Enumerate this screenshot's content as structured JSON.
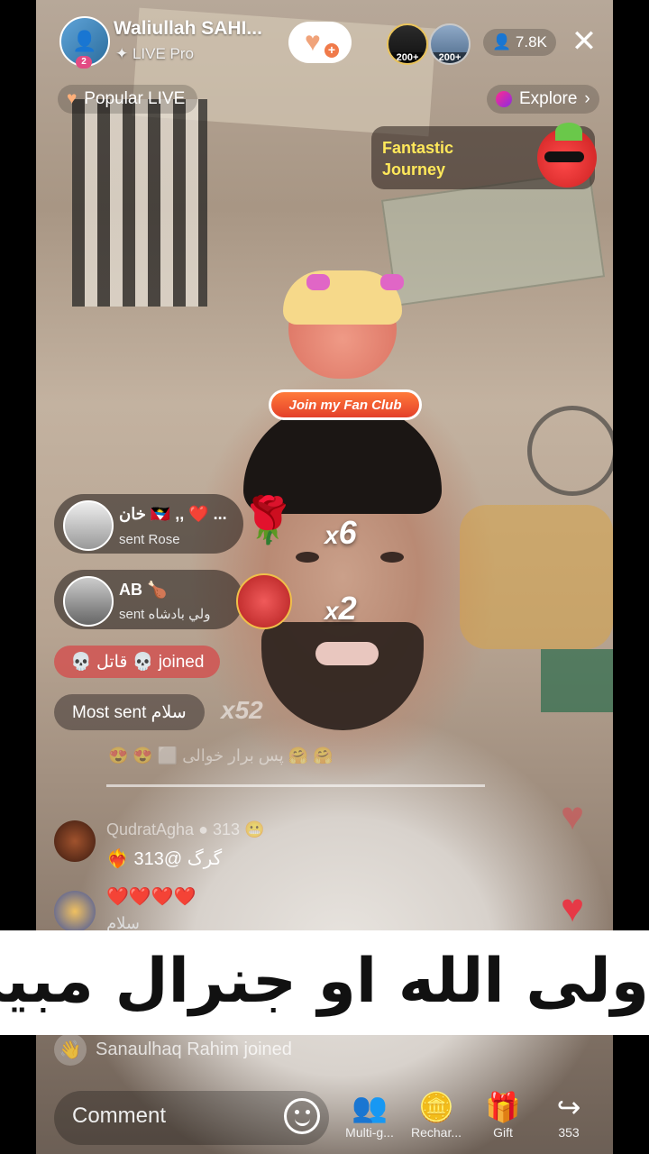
{
  "header": {
    "host_name": "Waliullah SAHI...",
    "host_badge": "2",
    "host_subtitle": "✦ LIVE Pro",
    "viewers": [
      {
        "badge": "200+"
      },
      {
        "badge": "200+"
      }
    ],
    "viewer_count": "7.8K",
    "viewer_icon": "person-icon",
    "close_icon": "close-icon"
  },
  "subnav": {
    "popular_label": "Popular LIVE",
    "explore_label": "Explore"
  },
  "promo": {
    "fantastic_line1": "Fantastic",
    "fantastic_line2": "Journey",
    "fan_club_label": "Join my Fan Club"
  },
  "gifts": [
    {
      "user": "خان 🇦🇬 ,, ❤️ ...",
      "action": "sent Rose",
      "icon": "rose-icon",
      "combo": "6"
    },
    {
      "user": "AB 🍗",
      "action": "sent ولي بادشاه",
      "icon": "badshah-gift-icon",
      "combo": "2"
    }
  ],
  "gift_combo_prefix": "x",
  "joined_pill": "💀 قاتل 💀 joined",
  "most_sent": "Most sent سلام",
  "most_sent_combo": "x52",
  "faint_comment": "😍 😍 ⬜ پس برار خوالی 🤗 🤗",
  "comments": [
    {
      "name": "QudratAgha ● 313 😬",
      "text": "❤️‍🔥 گرگ @313"
    },
    {
      "name": "",
      "text": "❤️❤️❤️❤️",
      "sub": "سلام"
    }
  ],
  "banner_text": "ولی الله او جنرال مبین",
  "joined_bottom": "Sanaulhaq Rahim joined",
  "bottom_bar": {
    "comment_placeholder": "Comment",
    "buttons": [
      {
        "label": "Multi-g...",
        "icon": "multi-guest-icon"
      },
      {
        "label": "Rechar...",
        "icon": "recharge-icon"
      },
      {
        "label": "Gift",
        "icon": "gift-icon"
      },
      {
        "label": "353",
        "icon": "share-icon"
      }
    ]
  },
  "colors": {
    "accent_red": "#e63946",
    "fan_club_orange": "#ff7a3a",
    "fantastic_yellow": "#ffe85a"
  }
}
